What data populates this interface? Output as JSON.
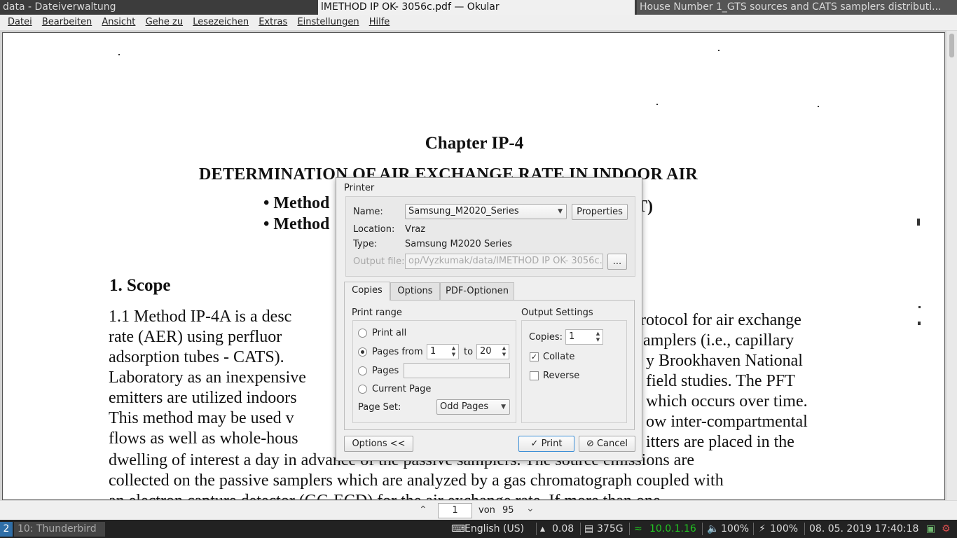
{
  "titlebar": {
    "left": "data - Dateiverwaltung",
    "active": "lMETHOD IP  OK- 3056c.pdf  — Okular",
    "right": "House Number 1_GTS sources and CATS samplers distributi..."
  },
  "menubar": [
    "Datei",
    "Bearbeiten",
    "Ansicht",
    "Gehe zu",
    "Lesezeichen",
    "Extras",
    "Einstellungen",
    "Hilfe"
  ],
  "document": {
    "chapter": "Chapter IP-4",
    "heading": "DETERMINATION OF AIR EXCHANGE RATE IN INDOOR AIR",
    "bullet1_start": "• Method",
    "bullet1_end": "T)",
    "bullet2_start": "• Method",
    "scope": "1.   Scope",
    "line1_left": "1.1  Method IP-4A is a desc",
    "line1_right": "rotocol for air exchange",
    "line2_left": "rate (AER) using perfluor",
    "line2_right": "amplers (i.e., capillary",
    "line3_left": "adsorption tubes - CATS).",
    "line3_right": "y Brookhaven National",
    "line4_left": "Laboratory as an inexpensive",
    "line4_right": "field studies.  The PFT",
    "line5_left": "emitters are utilized indoors",
    "line5_right": "which occurs over time.",
    "line6_left": "This method may be used v",
    "line6_right": "ow inter-compartmental",
    "line7_left": "flows as well as whole-hous",
    "line7_right": "itters are placed in the",
    "line8": "dwelling of interest a day in advance of the passive samplers.  The source emissions are",
    "line9": "collected on the passive samplers which are analyzed by a gas chromatograph coupled with",
    "line10": "an electron capture detector (GC-ECD) for the air exchange rate.  If more than one"
  },
  "pagebar": {
    "current_page": "1",
    "von": "von",
    "total": "95"
  },
  "dialog": {
    "title": "Printer",
    "name_label": "Name:",
    "printer_name": "Samsung_M2020_Series",
    "properties_button": "Properties",
    "location_label": "Location:",
    "location_value": "Vraz",
    "type_label": "Type:",
    "type_value": "Samsung M2020 Series",
    "output_file_label": "Output file:",
    "output_file_value": "op/Vyzkumak/data/lMETHOD IP  OK- 3056c.pdf",
    "browse_button": "...",
    "tabs": [
      "Copies",
      "Options",
      "PDF-Optionen"
    ],
    "print_range_title": "Print range",
    "print_all": "Print all",
    "pages_from": "Pages from",
    "from_value": "1",
    "to_label": "to",
    "to_value": "20",
    "pages": "Pages",
    "pages_value": "",
    "current_page": "Current Page",
    "page_set_label": "Page Set:",
    "page_set_value": "Odd Pages",
    "output_settings_title": "Output Settings",
    "copies_label": "Copies:",
    "copies_value": "1",
    "collate": "Collate",
    "collate_checked": true,
    "reverse": "Reverse",
    "reverse_checked": false,
    "options_button": "Options <<",
    "print_button": "Print",
    "cancel_button": "Cancel"
  },
  "taskbar": {
    "workspace": "2",
    "app": "10: Thunderbird",
    "keyboard": "English (US)",
    "load": "0.08",
    "disk": "375G",
    "ip": "10.0.1.16",
    "volume": "100%",
    "battery": "100%",
    "datetime": "08. 05. 2019 17:40:18",
    "ip_color": "#21c521"
  }
}
